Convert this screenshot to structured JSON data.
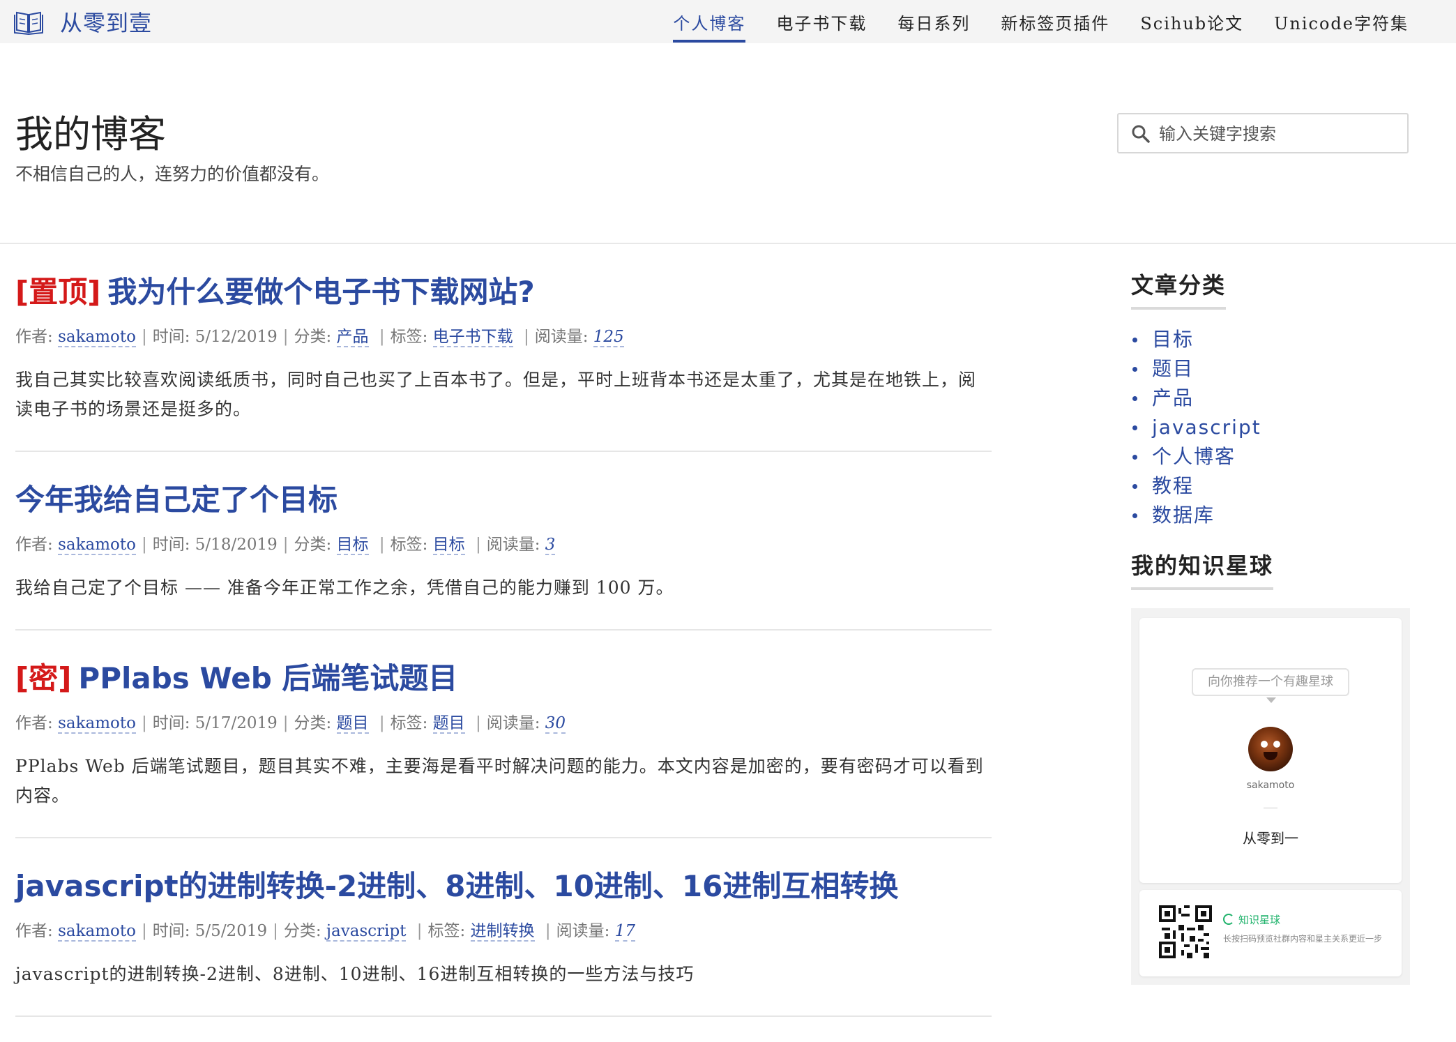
{
  "brand": {
    "name": "从零到壹",
    "icon": "open-book-icon"
  },
  "nav": {
    "items": [
      {
        "label": "个人博客",
        "active": true
      },
      {
        "label": "电子书下载",
        "active": false
      },
      {
        "label": "每日系列",
        "active": false
      },
      {
        "label": "新标签页插件",
        "active": false
      },
      {
        "label": "Scihub论文",
        "active": false
      },
      {
        "label": "Unicode字符集",
        "active": false
      }
    ]
  },
  "header": {
    "title": "我的博客",
    "subtitle": "不相信自己的人，连努力的价值都没有。"
  },
  "search": {
    "placeholder": "输入关键字搜索",
    "value": "",
    "icon": "search-icon"
  },
  "labels": {
    "author": "作者:",
    "time": "时间:",
    "category": "分类:",
    "tag": "标签:",
    "views": "阅读量:"
  },
  "posts": [
    {
      "prefix": "[置顶]",
      "title": "我为什么要做个电子书下载网站?",
      "author": "sakamoto",
      "date": "5/12/2019",
      "category": "产品",
      "tag": "电子书下载",
      "views": "125",
      "excerpt": "我自己其实比较喜欢阅读纸质书，同时自己也买了上百本书了。但是，平时上班背本书还是太重了，尤其是在地铁上，阅读电子书的场景还是挺多的。"
    },
    {
      "prefix": "",
      "title": "今年我给自己定了个目标",
      "author": "sakamoto",
      "date": "5/18/2019",
      "category": "目标",
      "tag": "目标",
      "views": "3",
      "excerpt": "我给自己定了个目标 —— 准备今年正常工作之余，凭借自己的能力赚到 100 万。"
    },
    {
      "prefix": "[密]",
      "title": "PPlabs Web 后端笔试题目",
      "author": "sakamoto",
      "date": "5/17/2019",
      "category": "题目",
      "tag": "题目",
      "views": "30",
      "excerpt": "PPlabs Web 后端笔试题目，题目其实不难，主要海是看平时解决问题的能力。本文内容是加密的，要有密码才可以看到内容。"
    },
    {
      "prefix": "",
      "title": "javascript的进制转换-2进制、8进制、10进制、16进制互相转换",
      "author": "sakamoto",
      "date": "5/5/2019",
      "category": "javascript",
      "tag": "进制转换",
      "views": "17",
      "excerpt": "javascript的进制转换-2进制、8进制、10进制、16进制互相转换的一些方法与技巧"
    }
  ],
  "sidebar": {
    "categories_title": "文章分类",
    "categories": [
      "目标",
      "题目",
      "产品",
      "javascript",
      "个人博客",
      "教程",
      "数据库"
    ],
    "planet_title": "我的知识星球",
    "planet": {
      "recommend": "向你推荐一个有趣星球",
      "owner": "sakamoto",
      "group_name": "从零到一",
      "app_name": "知识星球",
      "description": "长按扫码预览社群内容和星主关系更近一步"
    }
  },
  "colors": {
    "link": "#2b4aa0",
    "prefix_red": "#d41919",
    "app_green": "#1fb26b"
  }
}
